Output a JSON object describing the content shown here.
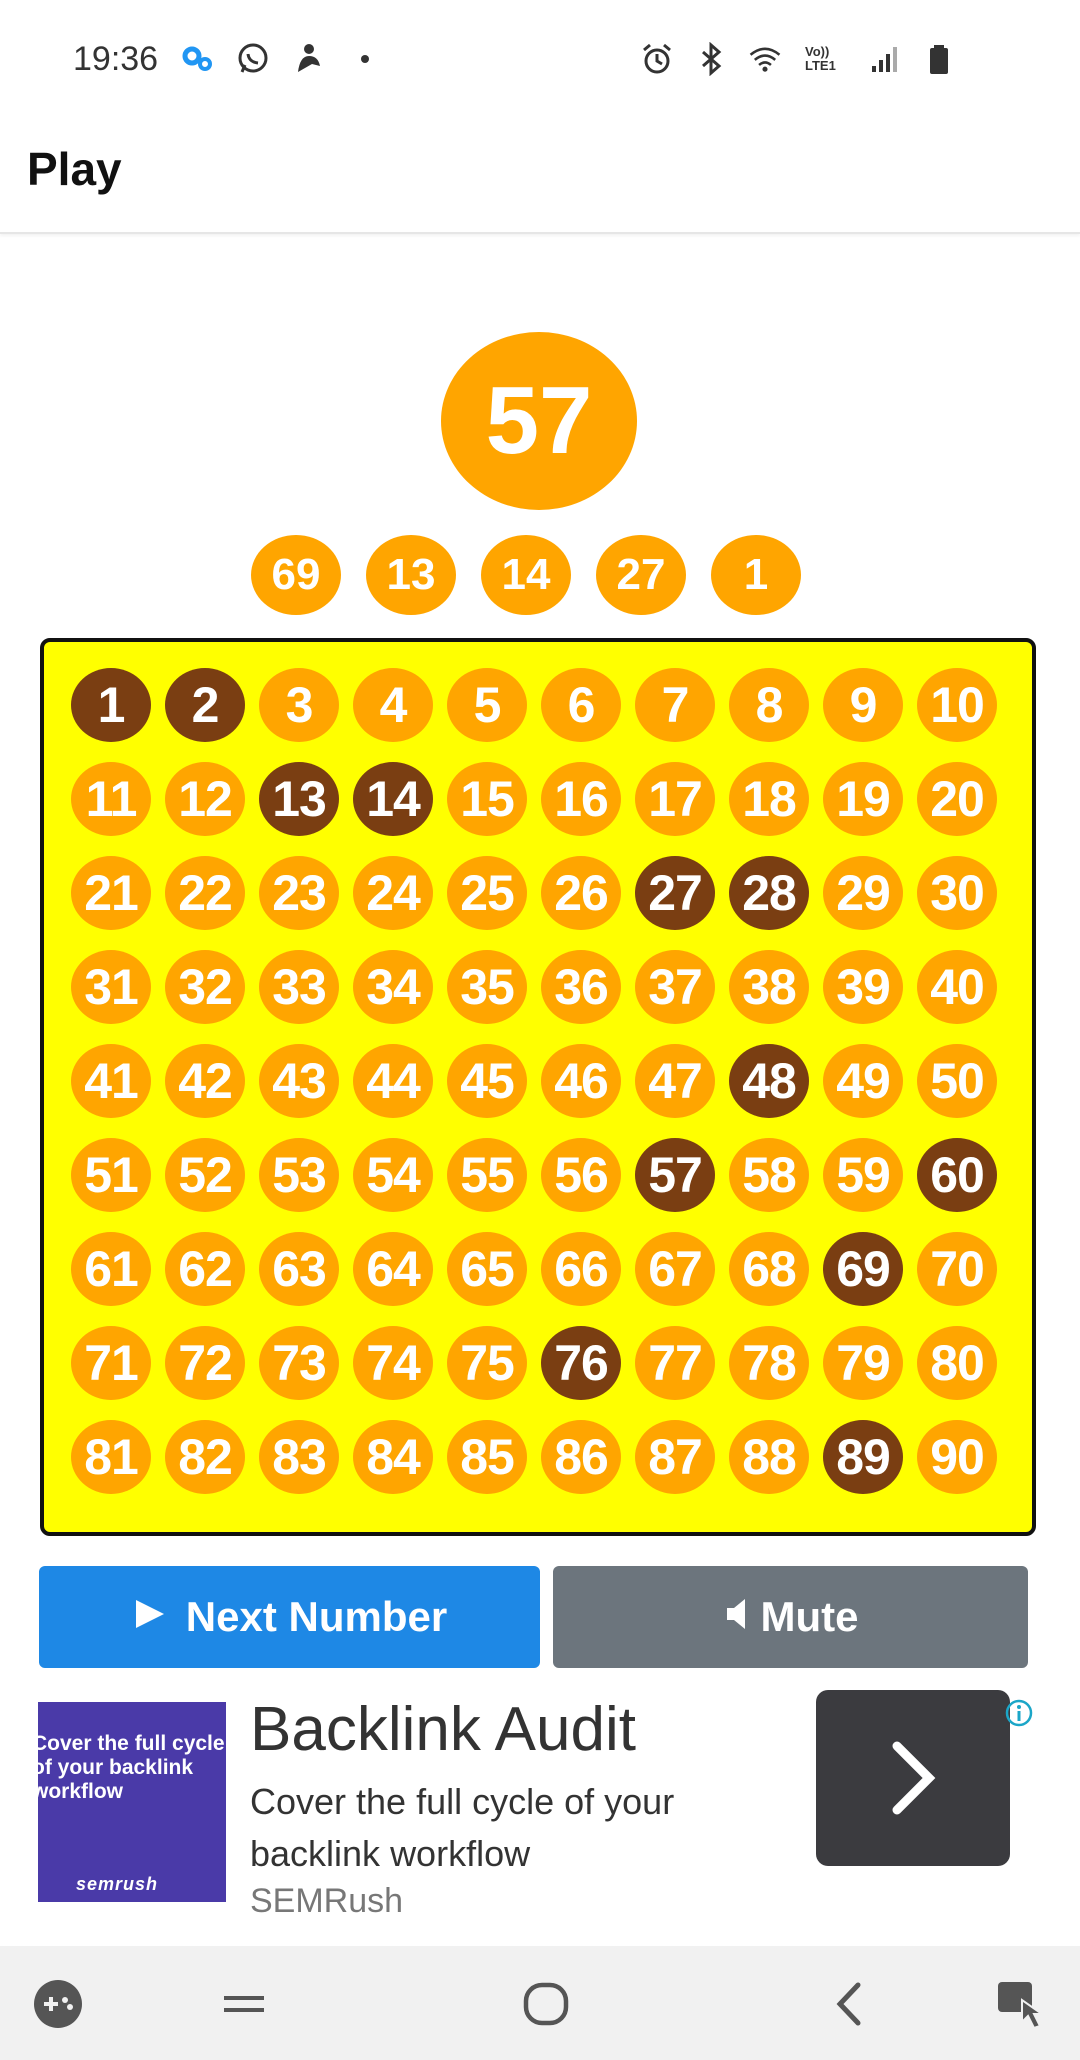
{
  "status_bar": {
    "time": "19:36",
    "left_icons": [
      "gears-icon",
      "whatsapp-icon",
      "figure-icon",
      "dot-icon"
    ],
    "right_icons": [
      "alarm-icon",
      "bluetooth-icon",
      "wifi-icon",
      "volte-icon",
      "signal-icon",
      "battery-icon"
    ],
    "volte_text": "Vo)) LTE1"
  },
  "header": {
    "title": "Play"
  },
  "current_number": "57",
  "recent_numbers": [
    "69",
    "13",
    "14",
    "27",
    "1"
  ],
  "board": {
    "numbers": [
      "1",
      "2",
      "3",
      "4",
      "5",
      "6",
      "7",
      "8",
      "9",
      "10",
      "11",
      "12",
      "13",
      "14",
      "15",
      "16",
      "17",
      "18",
      "19",
      "20",
      "21",
      "22",
      "23",
      "24",
      "25",
      "26",
      "27",
      "28",
      "29",
      "30",
      "31",
      "32",
      "33",
      "34",
      "35",
      "36",
      "37",
      "38",
      "39",
      "40",
      "41",
      "42",
      "43",
      "44",
      "45",
      "46",
      "47",
      "48",
      "49",
      "50",
      "51",
      "52",
      "53",
      "54",
      "55",
      "56",
      "57",
      "58",
      "59",
      "60",
      "61",
      "62",
      "63",
      "64",
      "65",
      "66",
      "67",
      "68",
      "69",
      "70",
      "71",
      "72",
      "73",
      "74",
      "75",
      "76",
      "77",
      "78",
      "79",
      "80",
      "81",
      "82",
      "83",
      "84",
      "85",
      "86",
      "87",
      "88",
      "89",
      "90"
    ],
    "called": [
      1,
      2,
      13,
      14,
      27,
      28,
      48,
      57,
      60,
      69,
      76,
      89
    ],
    "colors": {
      "board_bg": "#FFFF00",
      "uncalled": "#FFA500",
      "called": "#7A3E12"
    }
  },
  "buttons": {
    "next_label": "Next Number",
    "mute_label": "Mute",
    "next_color": "#1E88E5",
    "mute_color": "#6C757D"
  },
  "ad": {
    "image_text": "Cover the full cycle of your backlink workflow",
    "image_brand": "semrush",
    "title": "Backlink Audit",
    "description": "Cover the full cycle of your backlink workflow",
    "advertiser": "SEMRush"
  },
  "nav_bar": {
    "items": [
      "game-launcher-icon",
      "recent-apps-icon",
      "home-icon",
      "back-icon",
      "touch-assist-icon"
    ]
  }
}
